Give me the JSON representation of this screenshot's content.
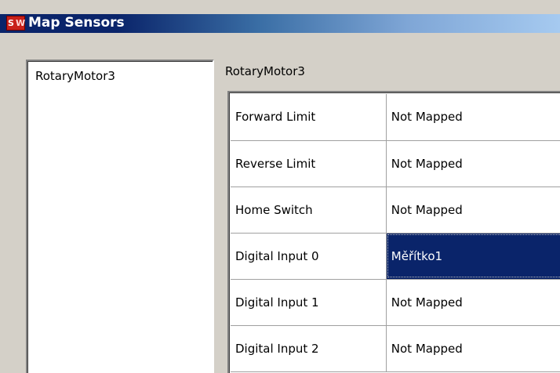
{
  "window": {
    "icon_text": [
      "S",
      "W"
    ],
    "title": "Map Sensors"
  },
  "motors": {
    "items": [
      "RotaryMotor3"
    ]
  },
  "sensor_panel": {
    "group_label": "RotaryMotor3",
    "rows": [
      {
        "sensor": "Forward Limit",
        "mapping": "Not Mapped",
        "selected": false
      },
      {
        "sensor": "Reverse Limit",
        "mapping": "Not Mapped",
        "selected": false
      },
      {
        "sensor": "Home Switch",
        "mapping": "Not Mapped",
        "selected": false
      },
      {
        "sensor": "Digital Input 0",
        "mapping": "Měřítko1",
        "selected": true
      },
      {
        "sensor": "Digital Input 1",
        "mapping": "Not Mapped",
        "selected": false
      },
      {
        "sensor": "Digital Input 2",
        "mapping": "Not Mapped",
        "selected": false
      }
    ]
  },
  "colors": {
    "title_bar": "#0a246a",
    "selection": "#0a246a",
    "dialog_background": "#d4d0c8",
    "app_icon": "#c8201a"
  }
}
